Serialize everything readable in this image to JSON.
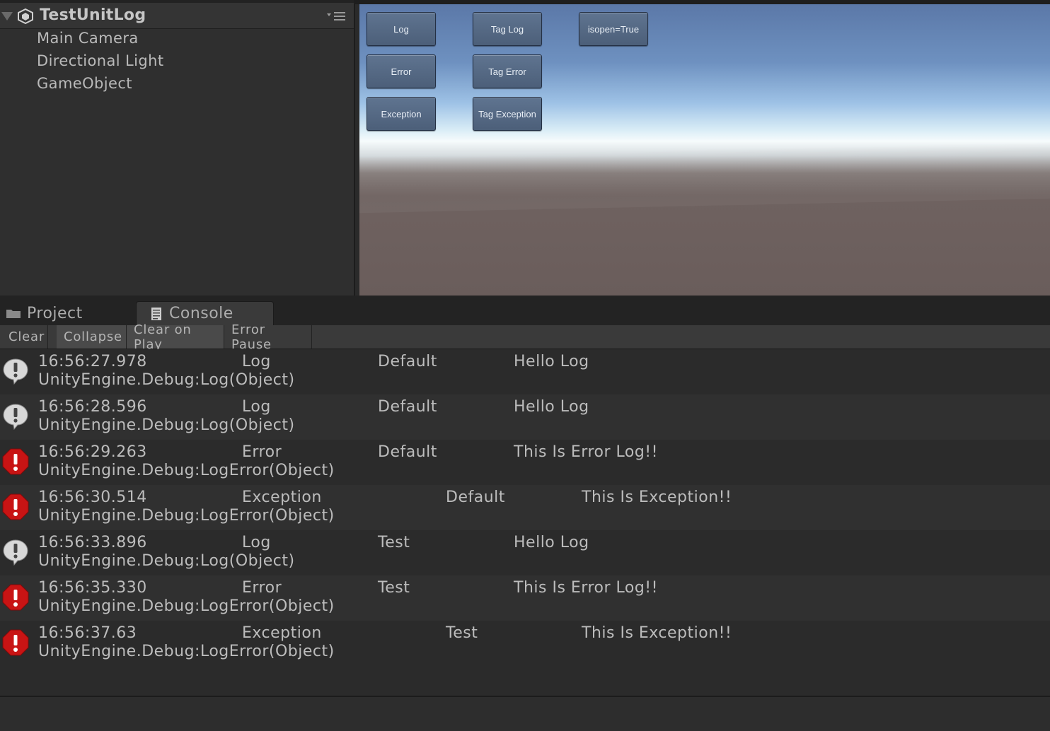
{
  "hierarchy": {
    "scene_title": "TestUnitLog",
    "items": [
      "Main Camera",
      "Directional Light",
      "GameObject"
    ]
  },
  "game_view": {
    "buttons": {
      "log": "Log",
      "tag_log": "Tag Log",
      "isopen": "isopen=True",
      "error": "Error",
      "tag_error": "Tag Error",
      "exception": "Exception",
      "tag_exception": "Tag Exception"
    }
  },
  "tabs": {
    "project": "Project",
    "console": "Console"
  },
  "toolbar": {
    "clear": "Clear",
    "collapse": "Collapse",
    "clear_on_play": "Clear on Play",
    "error_pause": "Error Pause"
  },
  "logs": [
    {
      "level": "info",
      "time": "16:56:27.978",
      "type": "Log",
      "tag": "Default",
      "message": "Hello Log",
      "stack": "UnityEngine.Debug:Log(Object)"
    },
    {
      "level": "info",
      "time": "16:56:28.596",
      "type": "Log",
      "tag": "Default",
      "message": "Hello Log",
      "stack": "UnityEngine.Debug:Log(Object)"
    },
    {
      "level": "error",
      "time": "16:56:29.263",
      "type": "Error",
      "tag": "Default",
      "message": "This Is Error Log!!",
      "stack": "UnityEngine.Debug:LogError(Object)"
    },
    {
      "level": "error",
      "time": "16:56:30.514",
      "type": "Exception",
      "tag": "Default",
      "message": "This Is Exception!!",
      "stack": "UnityEngine.Debug:LogError(Object)"
    },
    {
      "level": "info",
      "time": "16:56:33.896",
      "type": "Log",
      "tag": "Test",
      "message": "Hello Log",
      "stack": "UnityEngine.Debug:Log(Object)"
    },
    {
      "level": "error",
      "time": "16:56:35.330",
      "type": "Error",
      "tag": "Test",
      "message": "This Is Error Log!!",
      "stack": "UnityEngine.Debug:LogError(Object)"
    },
    {
      "level": "error",
      "time": "16:56:37.63",
      "type": "Exception",
      "tag": "Test",
      "message": "This Is Exception!!",
      "stack": "UnityEngine.Debug:LogError(Object)"
    }
  ],
  "colors": {
    "error_icon": "#c81414",
    "info_icon": "#d8d8d8",
    "button_bg": "#55697f"
  }
}
